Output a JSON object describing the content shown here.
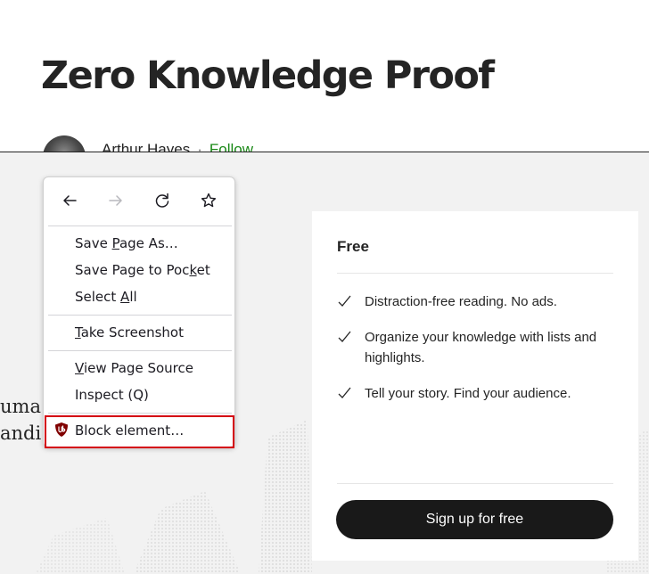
{
  "article": {
    "title": "Zero Knowledge Proof",
    "author_name": "Arthur Hayes",
    "separator": "·",
    "follow_label": "Follow"
  },
  "background_text": {
    "line1": "uma",
    "line2": "andi"
  },
  "plan_card": {
    "title": "Free",
    "features": [
      "Distraction-free reading. No ads.",
      "Organize your knowledge with lists and highlights.",
      "Tell your story. Find your audience."
    ],
    "signup_label": "Sign up for free"
  },
  "context_menu": {
    "nav_icons": [
      "back-arrow-icon",
      "forward-arrow-icon",
      "reload-icon",
      "bookmark-star-icon"
    ],
    "items": [
      {
        "label": "Save Page As…",
        "access_key": "P"
      },
      {
        "label": "Save Page to Pocket",
        "access_key": "k"
      },
      {
        "label": "Select All",
        "access_key": "A"
      },
      {
        "label": "Take Screenshot",
        "access_key": "T"
      },
      {
        "label": "View Page Source",
        "access_key": "V"
      },
      {
        "label": "Inspect (Q)",
        "access_key": ""
      },
      {
        "label": "Block element…",
        "access_key": "",
        "icon": "ublock-origin-icon"
      }
    ],
    "highlight_color": "#d40010"
  },
  "colors": {
    "follow_green": "#1a8917",
    "button_dark": "#191919",
    "overlay_gray": "#f2f2f2",
    "ublock_red": "#800000"
  }
}
